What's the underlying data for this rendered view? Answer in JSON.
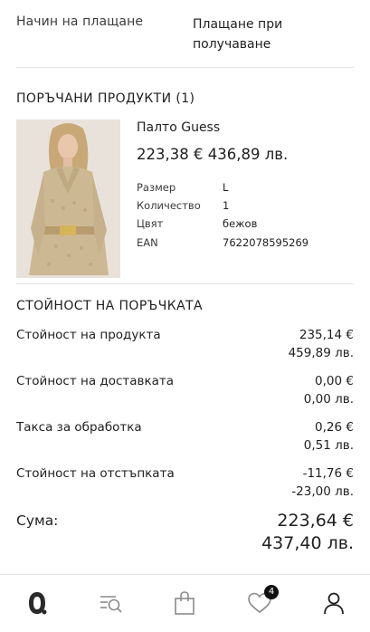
{
  "payment": {
    "label": "Начин на плащане",
    "value": "Плащане при получаване"
  },
  "ordered": {
    "title": "ПОРЪЧАНИ ПРОДУКТИ (1)",
    "product": {
      "name": "Палто Guess",
      "price": "223,38 € 436,89 лв.",
      "image_icon": "coat-product-image",
      "attributes": [
        {
          "label": "Размер",
          "value": "L"
        },
        {
          "label": "Количество",
          "value": "1"
        },
        {
          "label": "Цвят",
          "value": "бежов"
        },
        {
          "label": "EAN",
          "value": "7622078595269"
        }
      ]
    }
  },
  "summary": {
    "title": "СТОЙНОСТ НА ПОРЪЧКАТА",
    "rows": [
      {
        "label": "Стойност на продукта",
        "eur": "235,14 €",
        "bgn": "459,89 лв."
      },
      {
        "label": "Стойност на доставката",
        "eur": "0,00 €",
        "bgn": "0,00 лв."
      },
      {
        "label": "Такса за обработка",
        "eur": "0,26 €",
        "bgn": "0,51 лв."
      },
      {
        "label": "Стойност на отстъпката",
        "eur": "-11,76 €",
        "bgn": "-23,00 лв."
      }
    ],
    "total": {
      "label": "Сума:",
      "eur": "223,64 €",
      "bgn": "437,40 лв."
    }
  },
  "nav": {
    "items": [
      {
        "icon": "logo-icon"
      },
      {
        "icon": "search-list-icon"
      },
      {
        "icon": "shopping-bag-icon"
      },
      {
        "icon": "heart-icon",
        "badge": "4"
      },
      {
        "icon": "user-icon"
      }
    ]
  }
}
